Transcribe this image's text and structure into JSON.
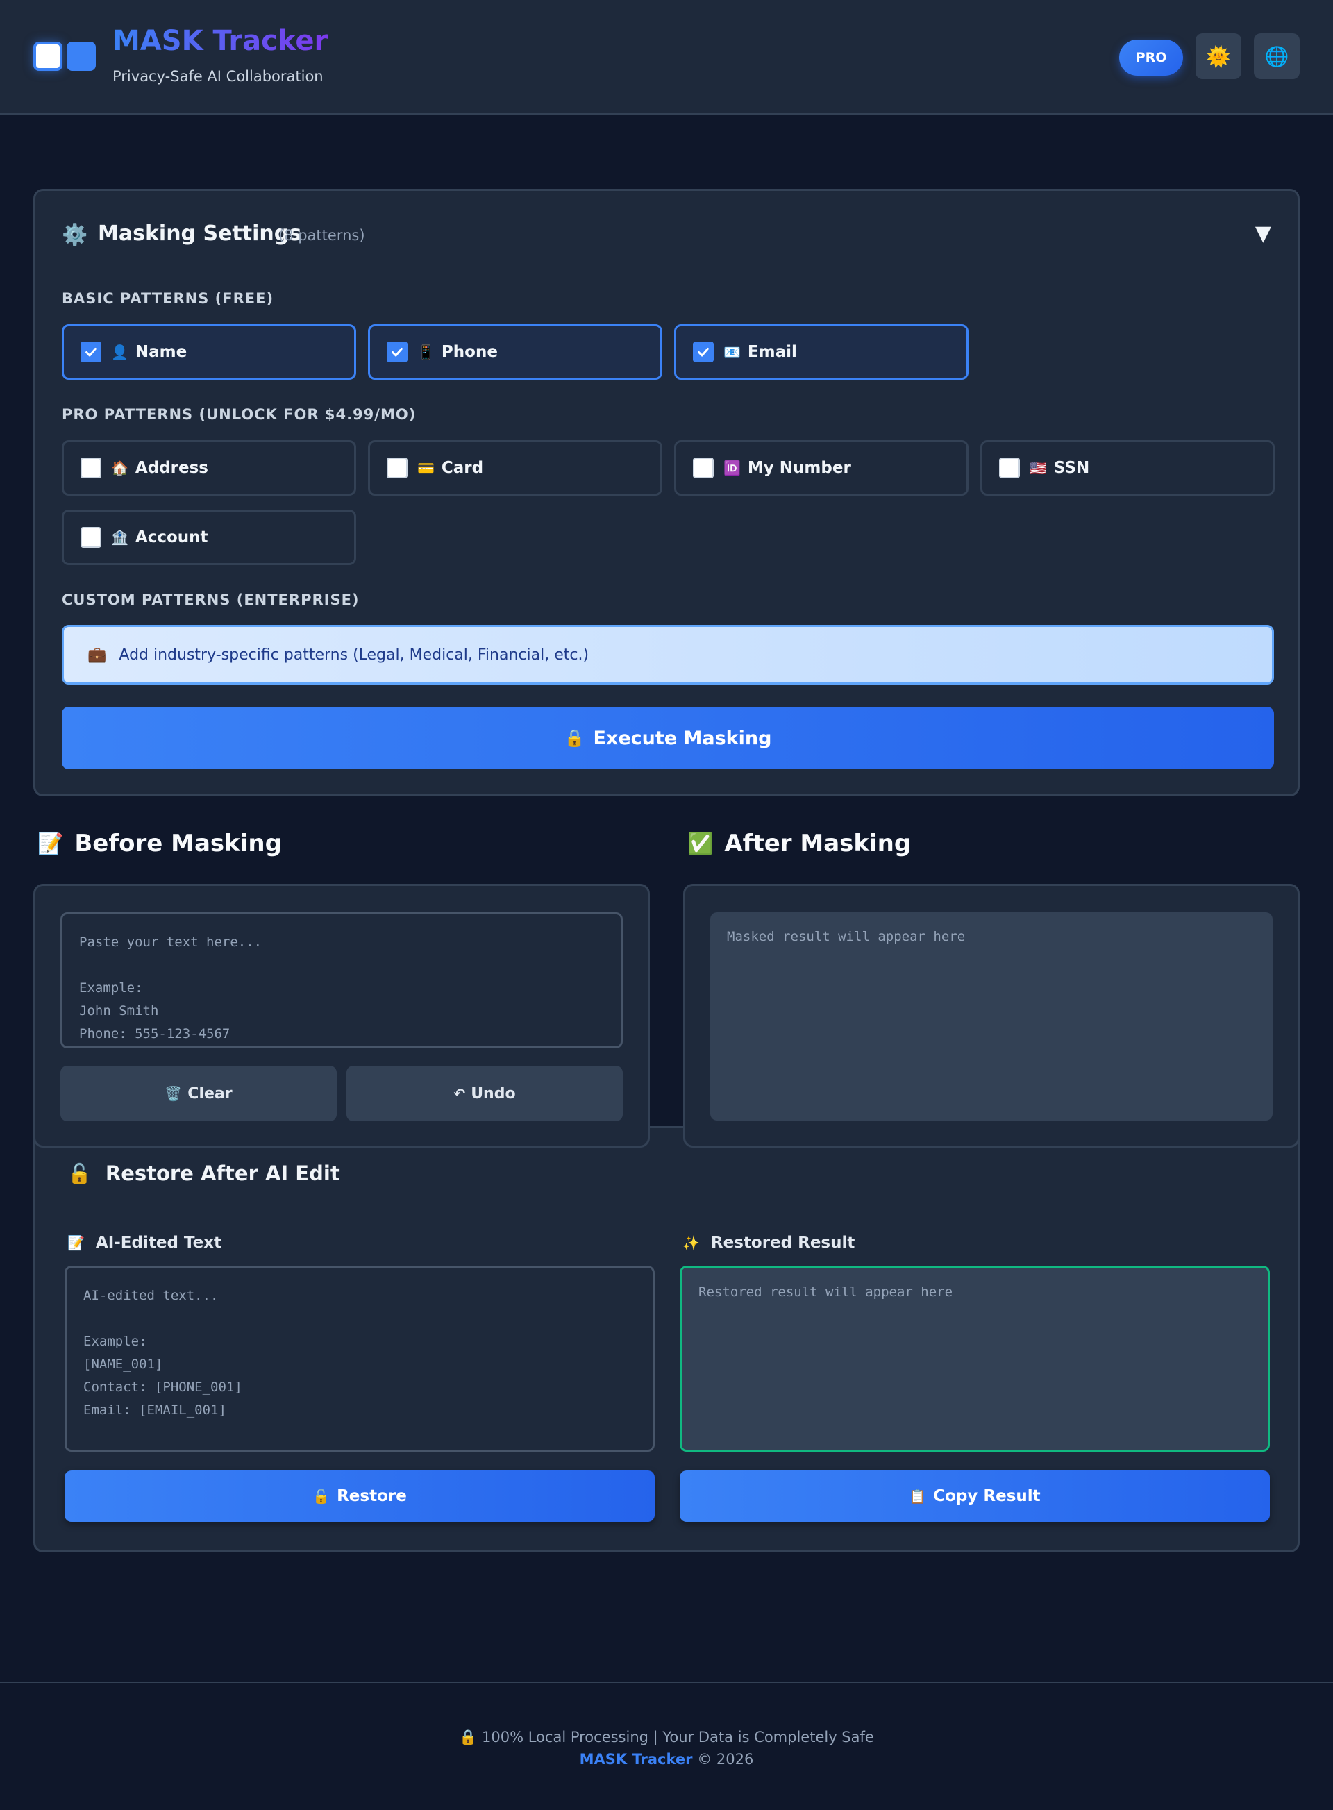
{
  "header": {
    "title": "MASK Tracker",
    "subtitle": "Privacy-Safe AI Collaboration",
    "pro_label": "PRO",
    "theme_icon": "🌞",
    "language_icon": "🌐"
  },
  "settings": {
    "icon": "⚙️",
    "title": "Masking Settings",
    "count": "(8 patterns)",
    "toggle": "▼",
    "basic_label": "BASIC PATTERNS (FREE)",
    "basic": [
      {
        "icon": "👤",
        "label": "Name",
        "checked": true
      },
      {
        "icon": "📱",
        "label": "Phone",
        "checked": true
      },
      {
        "icon": "📧",
        "label": "Email",
        "checked": true
      }
    ],
    "pro_label": "PRO PATTERNS (UNLOCK FOR $4.99/MO)",
    "pro": [
      {
        "icon": "🏠",
        "label": "Address",
        "checked": false
      },
      {
        "icon": "💳",
        "label": "Card",
        "checked": false
      },
      {
        "icon": "🆔",
        "label": "My Number",
        "checked": false
      },
      {
        "icon": "🇺🇸",
        "label": "SSN",
        "checked": false
      },
      {
        "icon": "🏦",
        "label": "Account",
        "checked": false
      }
    ],
    "custom_label": "CUSTOM PATTERNS (ENTERPRISE)",
    "custom_icon": "💼",
    "custom_text": "Add industry-specific patterns (Legal, Medical, Financial, etc.)",
    "execute_icon": "🔒",
    "execute_label": "Execute Masking"
  },
  "before": {
    "icon": "📝",
    "title": "Before Masking",
    "placeholder": "Paste your text here...\n\nExample:\nJohn Smith\nPhone: 555-123-4567",
    "clear_icon": "🗑️",
    "clear_label": "Clear",
    "undo_icon": "↶",
    "undo_label": "Undo"
  },
  "after": {
    "icon": "✅",
    "title": "After Masking",
    "placeholder": "Masked result will appear here"
  },
  "restore": {
    "icon": "🔓",
    "title": "Restore After AI Edit",
    "ai_icon": "📝",
    "ai_label": "AI-Edited Text",
    "ai_placeholder": "AI-edited text...\n\nExample:\n[NAME_001]\nContact: [PHONE_001]\nEmail: [EMAIL_001]",
    "result_icon": "✨",
    "result_label": "Restored Result",
    "result_placeholder": "Restored result will appear here",
    "restore_icon": "🔓",
    "restore_label": "Restore",
    "copy_icon": "📋",
    "copy_label": "Copy Result"
  },
  "footer": {
    "line1_icon": "🔒",
    "line1": "100% Local Processing | Your Data is Completely Safe",
    "brand": "MASK Tracker",
    "copyright": "© 2026"
  },
  "colors": {
    "background": "#0f172a",
    "panel": "#1e293b",
    "accent": "#3b82f6",
    "success": "#10b981"
  }
}
